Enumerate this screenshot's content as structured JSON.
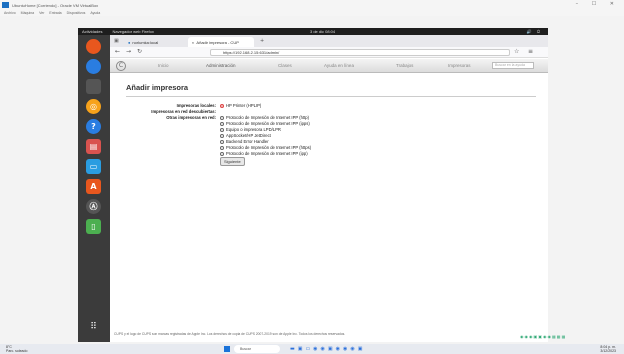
{
  "host": {
    "title": "UbuntuHome [Corriendo] - Oracle VM VirtualBox",
    "menu": [
      "Archivo",
      "Máquina",
      "Ver",
      "Entrada",
      "Dispositivos",
      "Ayuda"
    ],
    "window_controls": "– ☐ ✕"
  },
  "guest_topbar": {
    "activities": "Actividades",
    "app": "Navegador web Firefox",
    "clock": "3 de dic 08:04",
    "system": "🔊 ⏻"
  },
  "browser": {
    "tabs": [
      {
        "label": "norlumka:local"
      },
      {
        "label": "Añadir impresora - CUP"
      }
    ],
    "url": "https://192.168.2.15:631/admin/"
  },
  "cups_nav": {
    "items": [
      "Inicio",
      "Administración",
      "Clases",
      "Ayuda en línea",
      "Trabajos",
      "Impresoras"
    ],
    "active": "Administración",
    "search_placeholder": "Buscar en la ayuda"
  },
  "page": {
    "title": "Añadir impresora",
    "local_label": "Impresoras locales:",
    "local_printer": "HP Printer (HPLIP)",
    "discovered_label": "Impresoras en red descubiertas:",
    "other_label": "Otras impresoras en red:",
    "other_options": [
      "Protocolo de Impresión de Internet IPP (http)",
      "Protocolo de Impresión de Internet IPP (ipps)",
      "Equipo o impresora LPD/LPR",
      "AppSocket/HP JetDirect",
      "Backend Error Handler",
      "Protocolo de Impresión de Internet IPP (https)",
      "Protocolo de Impresión de Internet IPP (ipp)"
    ],
    "continue_button": "Siguiente",
    "footer": "CUPS y el logo de CUPS son marcas registradas de Apple Inc. Los derechos de copia de CUPS 2007-2019 son de Apple Inc. Todos los derechos reservados."
  },
  "taskbar": {
    "weather_temp": "8°C",
    "weather_desc": "Parc. soleado",
    "search": "Buscar",
    "time": "8:04 p. m.",
    "date": "3/12/2023"
  }
}
